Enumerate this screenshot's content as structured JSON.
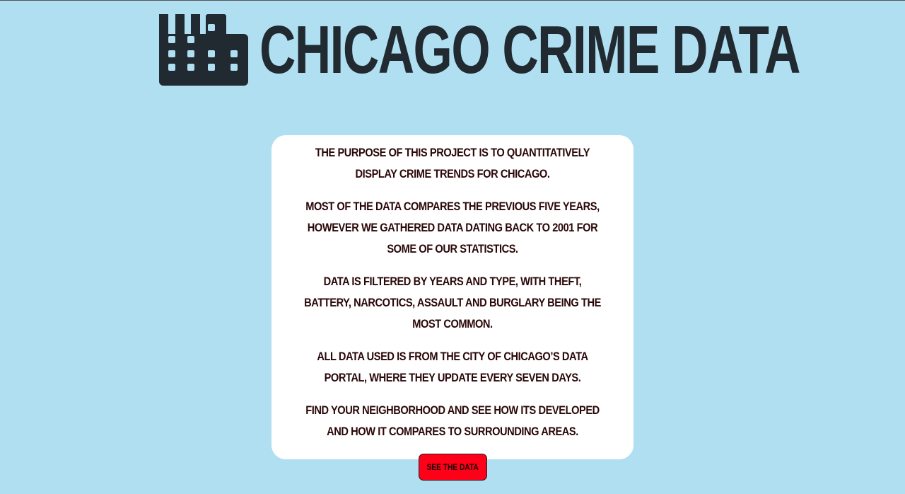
{
  "header": {
    "title": "Chicago Crime Data",
    "logo_icon": "city-buildings-icon"
  },
  "intro": {
    "paragraphs": [
      "The purpose of this project is to quantitatively display crime trends for Chicago.",
      "Most of the data compares the previous five years, however we gathered data dating back to 2001 for some of our statistics.",
      "Data is filtered by years and type, with theft, battery, narcotics, assault and burglary being the most common.",
      "All data used is from the City of Chicago’s Data Portal, where they update every seven days.",
      "Find your neighborhood and see how its developed and how it compares to surrounding areas."
    ],
    "button_label": "See the data"
  },
  "colors": {
    "background": "#b1dff2",
    "card": "#ffffff",
    "button": "#ff0019",
    "heading": "#202a30",
    "text": "#2a0708"
  }
}
